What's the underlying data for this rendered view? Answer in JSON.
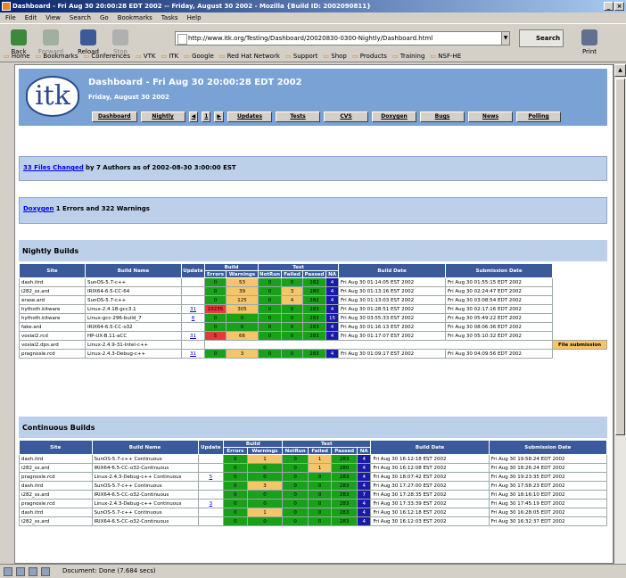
{
  "window": {
    "title": "Dashboard - Fri Aug 30 20:00:28 EDT 2002 -- Friday, August 30 2002 - Mozilla {Build ID: 2002090811}"
  },
  "menu": [
    "File",
    "Edit",
    "View",
    "Search",
    "Go",
    "Bookmarks",
    "Tasks",
    "Help"
  ],
  "toolbar": {
    "back": "Back",
    "forward": "Forward",
    "reload": "Reload",
    "stop": "Stop",
    "url": "http://www.itk.org/Testing/Dashboard/20020830-0300-Nightly/Dashboard.html",
    "search": "Search",
    "print": "Print"
  },
  "personal_toolbar": [
    "Home",
    "Bookmarks",
    "Conferences",
    "VTK",
    "ITK",
    "Google",
    "Red Hat Network",
    "Support",
    "Shop",
    "Products",
    "Training",
    "NSF-HE"
  ],
  "header": {
    "logo": "itk",
    "title": "Dashboard - Fri Aug 30 20:00:28 EDT 2002",
    "subtitle": "Friday, August 30 2002",
    "nav": [
      "Dashboard",
      "Nightly",
      "◀",
      "1",
      "▶",
      "Updates",
      "Tests",
      "CVS",
      "Doxygen",
      "Bugs",
      "News",
      "Polling"
    ]
  },
  "changed": {
    "link": "33 Files Changed",
    "text": "by 7 Authors as of 2002-08-30 3:00:00 EST"
  },
  "doxygen": {
    "link": "Doxygen",
    "text": "1 Errors and 322 Warnings"
  },
  "nightly": {
    "title": "Nightly Builds",
    "headers": {
      "site": "Site",
      "build_name": "Build Name",
      "update": "Update",
      "build": "Build",
      "test": "Test",
      "errors": "Errors",
      "warnings": "Warnings",
      "notrun": "NotRun",
      "failed": "Failed",
      "passed": "Passed",
      "na": "NA",
      "build_date": "Build Date",
      "sub_date": "Submission Date"
    },
    "rows": [
      {
        "site": "dash.itrd",
        "name": "SunOS-5.7-c++",
        "update": "",
        "errors": "0",
        "warnings": "53",
        "notrun": "0",
        "failed": "0",
        "passed": "282",
        "na": "4",
        "date": "Fri Aug 30 01:14:05 EST 2002",
        "sub": "Fri Aug 30 01:55:15 EDT 2002",
        "ecls": "g",
        "wcls": "o",
        "fcls": "g"
      },
      {
        "site": "i282_ss.ard",
        "name": "IRIX64-6.5-CC-64",
        "update": "",
        "errors": "0",
        "warnings": "39",
        "notrun": "0",
        "failed": "3",
        "passed": "280",
        "na": "4",
        "date": "Fri Aug 30 01:13:16 EST 2002",
        "sub": "Fri Aug 30 02:24:47 EDT 2002",
        "ecls": "g",
        "wcls": "o",
        "fcls": "o"
      },
      {
        "site": "erase.ard",
        "name": "SunOS-5.7-c++",
        "update": "",
        "errors": "0",
        "warnings": "125",
        "notrun": "0",
        "failed": "4",
        "passed": "282",
        "na": "4",
        "date": "Fri Aug 30 01:13:03 EST 2002",
        "sub": "Fri Aug 30 03:08:54 EDT 2002",
        "ecls": "g",
        "wcls": "o",
        "fcls": "o"
      },
      {
        "site": "hythoth.kitware",
        "name": "Linux-2.4.18-gcc3.1",
        "update": "31",
        "errors": "10235",
        "warnings": "305",
        "notrun": "0",
        "failed": "0",
        "passed": "283",
        "na": "4",
        "date": "Fri Aug 30 01:28:51 EST 2002",
        "sub": "Fri Aug 30 02:17:16 EDT 2002",
        "ecls": "r",
        "wcls": "o",
        "fcls": "g"
      },
      {
        "site": "hythoth.kitware",
        "name": "Linux-gcc-296-build_7",
        "update": "8",
        "errors": "0",
        "warnings": "0",
        "notrun": "0",
        "failed": "0",
        "passed": "283",
        "na": "15",
        "date": "Fri Aug 30 03:55:33 EST 2002",
        "sub": "Fri Aug 30 05:49:22 EDT 2002",
        "ecls": "g",
        "wcls": "g",
        "fcls": "g"
      },
      {
        "site": "fake.ard",
        "name": "IRIX64-6.5-CC-o32",
        "update": "",
        "errors": "0",
        "warnings": "0",
        "notrun": "0",
        "failed": "0",
        "passed": "283",
        "na": "4",
        "date": "Fri Aug 30 01:16:13 EST 2002",
        "sub": "Fri Aug 30 08:06:36 EDT 2002",
        "ecls": "g",
        "wcls": "g",
        "fcls": "g"
      },
      {
        "site": "vosial2.rcd",
        "name": "HP-UX-B.11-aCC",
        "update": "31",
        "errors": "5",
        "warnings": "66",
        "notrun": "0",
        "failed": "0",
        "passed": "283",
        "na": "4",
        "date": "Fri Aug 30 01:17:07 EST 2002",
        "sub": "Fri Aug 30 05:10:32 EDT 2002",
        "ecls": "r",
        "wcls": "o",
        "fcls": "g"
      },
      {
        "site": "vosial2.dps.ard",
        "name": "Linux-2.4.9-31-Intel-c++",
        "update": "",
        "errors": "",
        "warnings": "",
        "notrun": "",
        "failed": "",
        "passed": "",
        "na": "",
        "date": "",
        "sub": "File submission",
        "ecls": "",
        "wcls": "",
        "fcls": ""
      },
      {
        "site": "pragnosle.rcd",
        "name": "Linux-2.4.3-Debug-c++",
        "update": "31",
        "errors": "0",
        "warnings": "3",
        "notrun": "0",
        "failed": "0",
        "passed": "283",
        "na": "4",
        "date": "Fri Aug 30 01:09:17 EST 2002",
        "sub": "Fri Aug 30 04:09:56 EDT 2002",
        "ecls": "g",
        "wcls": "o",
        "fcls": "g"
      }
    ]
  },
  "continuous": {
    "title": "Continuous Builds",
    "rows": [
      {
        "site": "dash.itrd",
        "name": "SunOS-5.7-c++ Continuous",
        "update": "",
        "errors": "0",
        "warnings": "1",
        "notrun": "0",
        "failed": "1",
        "passed": "283",
        "na": "4",
        "date": "Fri Aug 30 16:12:18 EST 2002",
        "sub": "Fri Aug 30 19:58:24 EDT 2002",
        "wcls": "o",
        "fcls": "o"
      },
      {
        "site": "i282_ss.ard",
        "name": "IRIX64-6.5-CC-o32-Continuous",
        "update": "",
        "errors": "0",
        "warnings": "0",
        "notrun": "0",
        "failed": "1",
        "passed": "280",
        "na": "4",
        "date": "Fri Aug 30 16:12:08 EST 2002",
        "sub": "Fri Aug 30 18:26:24 EDT 2002",
        "wcls": "g",
        "fcls": "o"
      },
      {
        "site": "pragnosle.rcd",
        "name": "Linux-2.4.3-Debug-c++ Continuous",
        "update": "5",
        "errors": "0",
        "warnings": "0",
        "notrun": "0",
        "failed": "0",
        "passed": "283",
        "na": "4",
        "date": "Fri Aug 30 18:07:42 EST 2002",
        "sub": "Fri Aug 30 19:23:35 EDT 2002",
        "wcls": "g",
        "fcls": "g"
      },
      {
        "site": "dash.itrd",
        "name": "SunOS-5.7-c++ Continuous",
        "update": "",
        "errors": "0",
        "warnings": "3",
        "notrun": "0",
        "failed": "0",
        "passed": "283",
        "na": "4",
        "date": "Fri Aug 30 17:27:00 EST 2002",
        "sub": "Fri Aug 30 17:58:23 EDT 2002",
        "wcls": "o",
        "fcls": "g"
      },
      {
        "site": "i282_ss.ard",
        "name": "IRIX64-6.5-CC-o32-Continuous",
        "update": "",
        "errors": "0",
        "warnings": "0",
        "notrun": "0",
        "failed": "0",
        "passed": "283",
        "na": "7",
        "date": "Fri Aug 30 17:28:35 EST 2002",
        "sub": "Fri Aug 30 18:16:10 EDT 2002",
        "wcls": "g",
        "fcls": "g"
      },
      {
        "site": "pragnosle.rcd",
        "name": "Linux-2.4.3-Debug-c++ Continuous",
        "update": "3",
        "errors": "0",
        "warnings": "0",
        "notrun": "0",
        "failed": "0",
        "passed": "283",
        "na": "4",
        "date": "Fri Aug 30 17:33:39 EST 2002",
        "sub": "Fri Aug 30 17:45:19 EDT 2002",
        "wcls": "g",
        "fcls": "g"
      },
      {
        "site": "dash.itrd",
        "name": "SunOS-5.7-c++ Continuous",
        "update": "",
        "errors": "0",
        "warnings": "1",
        "notrun": "0",
        "failed": "0",
        "passed": "283",
        "na": "4",
        "date": "Fri Aug 30 16:12:18 EST 2002",
        "sub": "Fri Aug 30 16:28:05 EDT 2002",
        "wcls": "o",
        "fcls": "g"
      },
      {
        "site": "i282_ss.ard",
        "name": "IRIX64-6.5-CC-o32-Continuous",
        "update": "",
        "errors": "0",
        "warnings": "0",
        "notrun": "0",
        "failed": "0",
        "passed": "283",
        "na": "4",
        "date": "Fri Aug 30 16:12:03 EST 2002",
        "sub": "Fri Aug 30 16:32:37 EDT 2002",
        "wcls": "g",
        "fcls": "g"
      }
    ]
  },
  "status": "Document: Done (7.684 secs)"
}
